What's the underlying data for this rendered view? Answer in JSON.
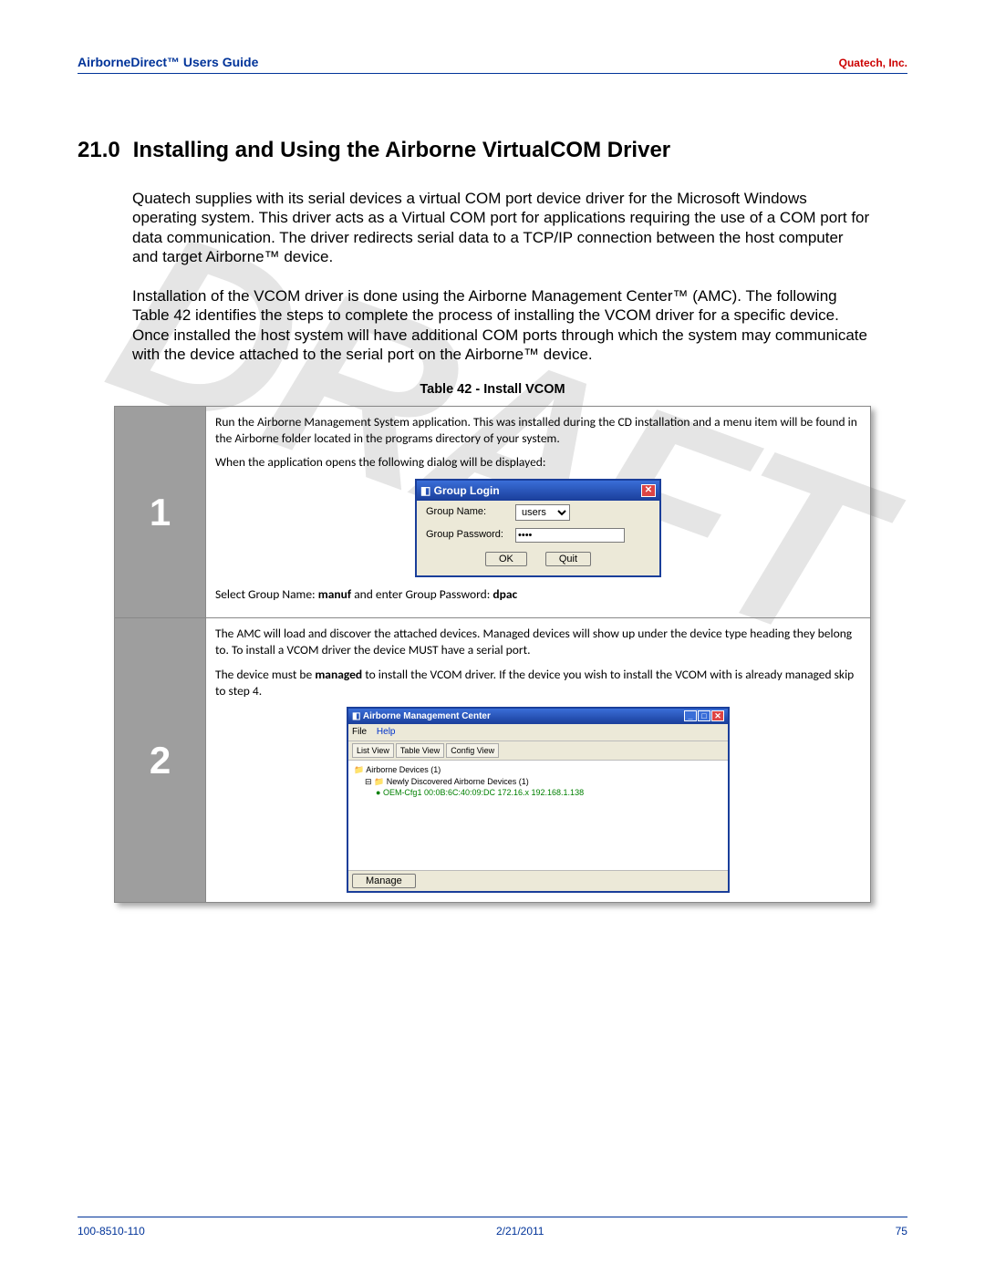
{
  "watermark": "DRAFT",
  "header": {
    "left": "AirborneDirect™ Users Guide",
    "right": "Quatech, Inc."
  },
  "section": {
    "number": "21.0",
    "title": "Installing and Using the Airborne VirtualCOM Driver"
  },
  "paragraphs": {
    "p1": "Quatech supplies with its serial devices a virtual COM port device driver for the Microsoft Windows operating system. This driver acts as a Virtual COM port for applications requiring the use of a COM port for data communication. The driver redirects serial data to a TCP/IP connection between the host computer and target Airborne™ device.",
    "p2": "Installation of the VCOM driver is done using the Airborne Management Center™ (AMC). The following Table 42 identifies the steps to complete the process of installing the VCOM driver for a specific device. Once installed the host system will have additional COM ports through which the system may communicate with the device attached to the serial port on the Airborne™ device."
  },
  "table_caption": "Table 42 - Install VCOM",
  "steps": {
    "s1": {
      "num": "1",
      "intro": "Run the Airborne Management System application. This was installed during the CD installation and a menu item will be found in the Airborne folder located in the programs directory of your system.",
      "opens": "When the application opens the following dialog will be displayed:",
      "dialog": {
        "title": "Group Login",
        "group_name_label": "Group Name:",
        "group_name_value": "users",
        "group_password_label": "Group Password:",
        "password_masked": "••••",
        "ok": "OK",
        "quit": "Quit"
      },
      "select_prefix": "Select Group Name: ",
      "select_gn": "manuf",
      "select_mid": " and enter Group Password: ",
      "select_pw": "dpac"
    },
    "s2": {
      "num": "2",
      "p1": "The AMC will load and discover the attached devices. Managed devices will show up under the device type heading they belong to. To install a VCOM driver the device MUST have a serial port.",
      "p2a": "The device must be ",
      "p2b": "managed",
      "p2c": " to install the VCOM driver. If the device you wish to install the VCOM with is already managed skip to step 4.",
      "amc": {
        "title": "Airborne Management Center",
        "menu_file": "File",
        "menu_help": "Help",
        "tb_list": "List View",
        "tb_table": "Table View",
        "tb_config": "Config View",
        "tree_root": "Airborne Devices (1)",
        "tree_node": "Newly Discovered Airborne Devices (1)",
        "tree_leaf": "OEM-Cfg1   00:0B:6C:40:09:DC   172.16.x   192.168.1.138",
        "manage_btn": "Manage"
      }
    }
  },
  "footer": {
    "left": "100-8510-110",
    "center": "2/21/2011",
    "right": "75"
  }
}
